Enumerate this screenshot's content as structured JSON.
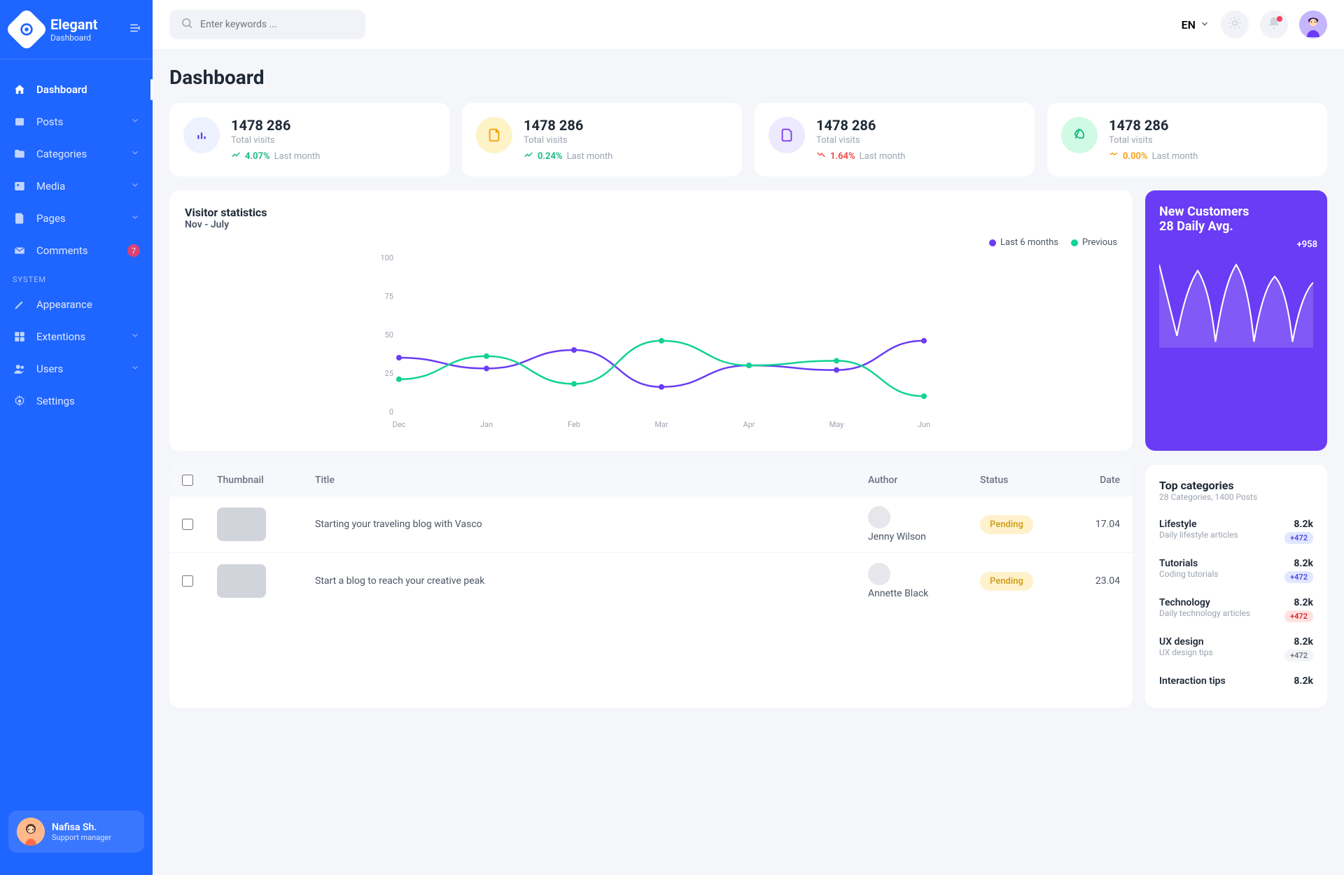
{
  "brand": {
    "title": "Elegant",
    "subtitle": "Dashboard"
  },
  "sidebar": {
    "items": [
      {
        "label": "Dashboard",
        "active": true,
        "icon": "home-icon"
      },
      {
        "label": "Posts",
        "icon": "posts-icon",
        "chevron": true
      },
      {
        "label": "Categories",
        "icon": "folder-icon",
        "chevron": true
      },
      {
        "label": "Media",
        "icon": "image-icon",
        "chevron": true
      },
      {
        "label": "Pages",
        "icon": "page-icon",
        "chevron": true
      },
      {
        "label": "Comments",
        "icon": "mail-icon",
        "badge": "7"
      }
    ],
    "section_label": "SYSTEM",
    "system": [
      {
        "label": "Appearance",
        "icon": "pen-icon"
      },
      {
        "label": "Extentions",
        "icon": "grid-icon",
        "chevron": true
      },
      {
        "label": "Users",
        "icon": "users-icon",
        "chevron": true
      },
      {
        "label": "Settings",
        "icon": "gear-icon"
      }
    ]
  },
  "user": {
    "name": "Nafisa Sh.",
    "role": "Support manager"
  },
  "topbar": {
    "search_placeholder": "Enter keywords ...",
    "lang": "EN"
  },
  "page_title": "Dashboard",
  "stats": [
    {
      "value": "1478 286",
      "label": "Total visits",
      "pct": "4.07%",
      "dir": "up",
      "period": "Last month",
      "icon": "bars-icon",
      "bg": "#eef2ff",
      "fg": "#4f46e5"
    },
    {
      "value": "1478 286",
      "label": "Total visits",
      "pct": "0.24%",
      "dir": "up",
      "period": "Last month",
      "icon": "file-icon",
      "bg": "#fef3c7",
      "fg": "#f59e0b"
    },
    {
      "value": "1478 286",
      "label": "Total visits",
      "pct": "1.64%",
      "dir": "down",
      "period": "Last month",
      "icon": "doc-icon",
      "bg": "#ede9fe",
      "fg": "#7c3aed"
    },
    {
      "value": "1478 286",
      "label": "Total visits",
      "pct": "0.00%",
      "dir": "flat",
      "period": "Last month",
      "icon": "leaf-icon",
      "bg": "#d1fae5",
      "fg": "#10b981"
    }
  ],
  "chart": {
    "title": "Visitor statistics",
    "subtitle": "Nov - July",
    "legend": [
      {
        "label": "Last 6 months",
        "color": "#6a3cf5"
      },
      {
        "label": "Previous",
        "color": "#10d295"
      }
    ]
  },
  "chart_data": {
    "type": "line",
    "categories": [
      "Dec",
      "Jan",
      "Feb",
      "Mar",
      "Apr",
      "May",
      "Jun"
    ],
    "series": [
      {
        "name": "Last 6 months",
        "values": [
          35,
          28,
          40,
          16,
          30,
          27,
          46
        ],
        "color": "#6a3cf5"
      },
      {
        "name": "Previous",
        "values": [
          21,
          36,
          18,
          46,
          30,
          33,
          10
        ],
        "color": "#10d295"
      }
    ],
    "ylim": [
      0,
      100
    ],
    "yticks": [
      0,
      25,
      50,
      75,
      100
    ],
    "xlabel": "",
    "ylabel": ""
  },
  "newcust": {
    "title": "New Customers",
    "subtitle": "28 Daily Avg.",
    "tag": "+958"
  },
  "table": {
    "headers": [
      "Thumbnail",
      "Title",
      "Author",
      "Status",
      "Date"
    ],
    "rows": [
      {
        "title": "Starting your traveling blog with Vasco",
        "author": "Jenny Wilson",
        "status": "Pending",
        "date": "17.04"
      },
      {
        "title": "Start a blog to reach your creative peak",
        "author": "Annette Black",
        "status": "Pending",
        "date": "23.04"
      }
    ]
  },
  "cats": {
    "title": "Top categories",
    "subtitle": "28 Categories, 1400 Posts",
    "rows": [
      {
        "name": "Lifestyle",
        "desc": "Daily lifestyle articles",
        "count": "8.2k",
        "badge": "+472",
        "badge_cls": "blue"
      },
      {
        "name": "Tutorials",
        "desc": "Coding tutorials",
        "count": "8.2k",
        "badge": "+472",
        "badge_cls": "blue"
      },
      {
        "name": "Technology",
        "desc": "Daily technology articles",
        "count": "8.2k",
        "badge": "+472",
        "badge_cls": "red"
      },
      {
        "name": "UX design",
        "desc": "UX design tips",
        "count": "8.2k",
        "badge": "+472",
        "badge_cls": "gray"
      },
      {
        "name": "Interaction tips",
        "desc": "",
        "count": "8.2k",
        "badge": "",
        "badge_cls": ""
      }
    ]
  }
}
